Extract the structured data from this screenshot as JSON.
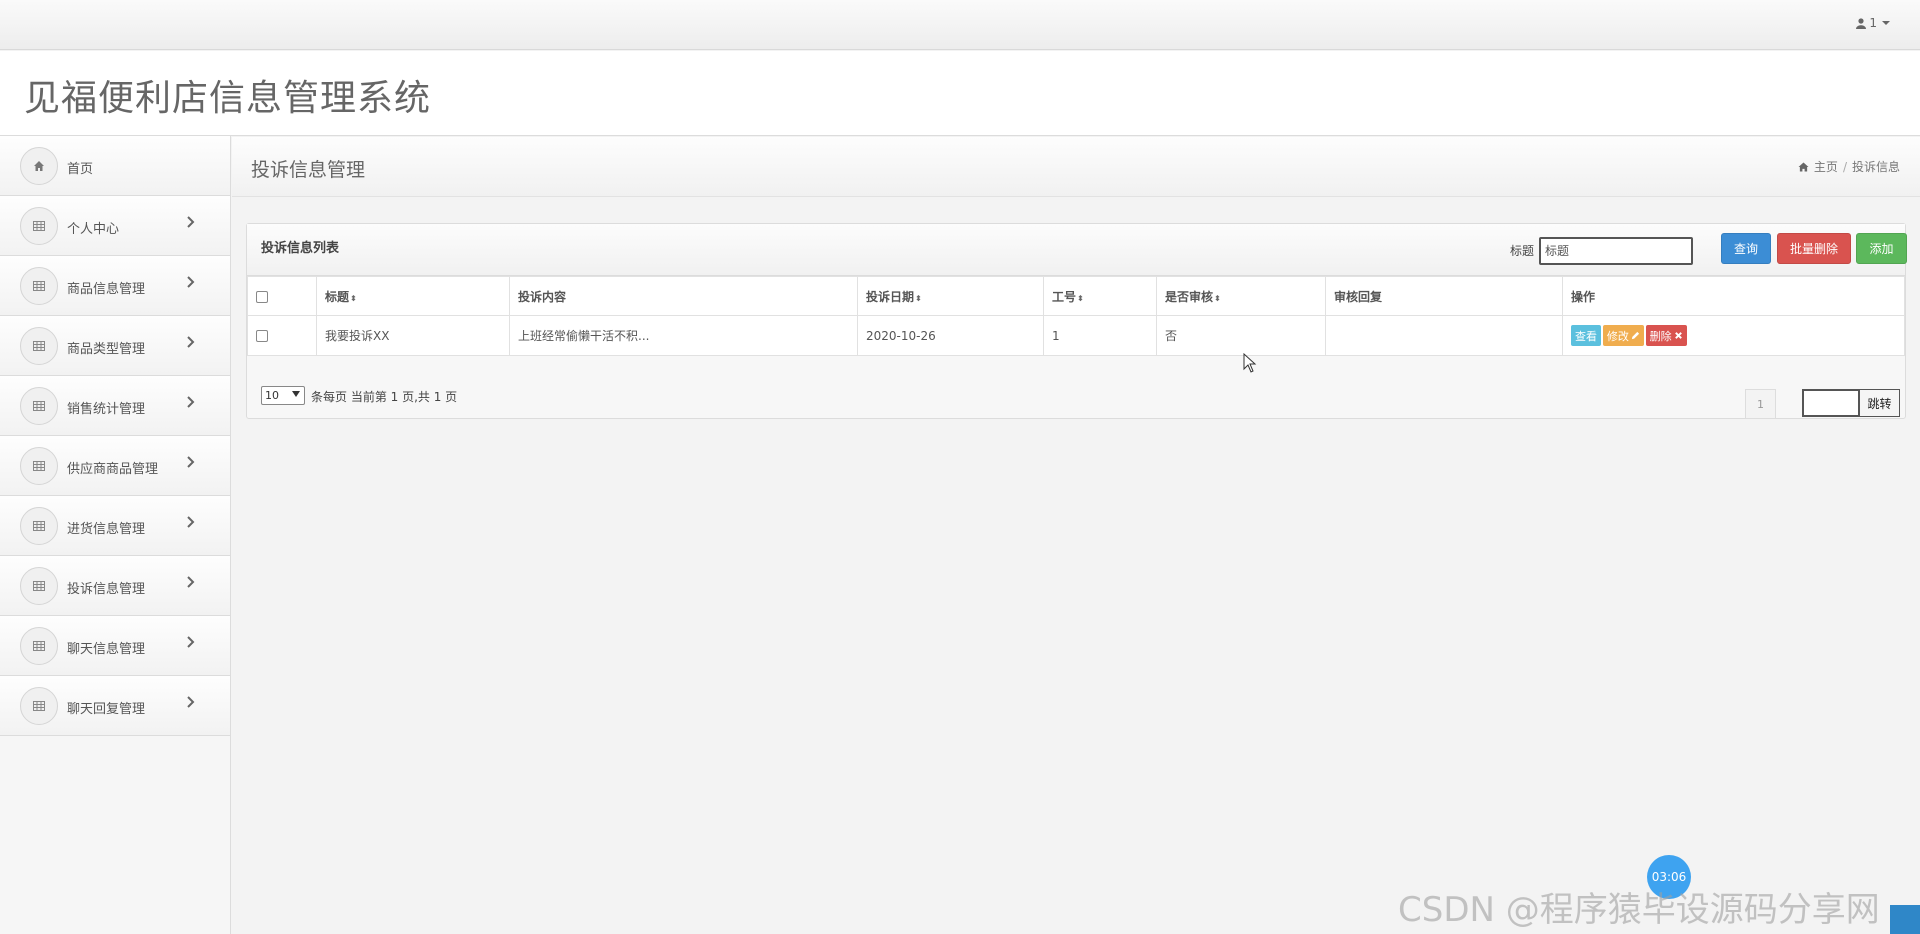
{
  "topbar": {
    "user_label": "1"
  },
  "header": {
    "app_title": "见福便利店信息管理系统"
  },
  "sidebar": {
    "items": [
      {
        "label": "首页",
        "icon": "home-icon",
        "has_arrow": false
      },
      {
        "label": "个人中心",
        "icon": "table-icon",
        "has_arrow": true
      },
      {
        "label": "商品信息管理",
        "icon": "table-icon",
        "has_arrow": true
      },
      {
        "label": "商品类型管理",
        "icon": "table-icon",
        "has_arrow": true
      },
      {
        "label": "销售统计管理",
        "icon": "table-icon",
        "has_arrow": true
      },
      {
        "label": "供应商商品管理",
        "icon": "table-icon",
        "has_arrow": true
      },
      {
        "label": "进货信息管理",
        "icon": "table-icon",
        "has_arrow": true
      },
      {
        "label": "投诉信息管理",
        "icon": "table-icon",
        "has_arrow": true
      },
      {
        "label": "聊天信息管理",
        "icon": "table-icon",
        "has_arrow": true
      },
      {
        "label": "聊天回复管理",
        "icon": "table-icon",
        "has_arrow": true
      }
    ]
  },
  "main": {
    "page_title": "投诉信息管理",
    "breadcrumb": {
      "home": "主页",
      "separator": "/",
      "current": "投诉信息"
    },
    "panel": {
      "title": "投诉信息列表",
      "search": {
        "label": "标题",
        "placeholder": "标题"
      },
      "buttons": {
        "query": "查询",
        "batch_delete": "批量删除",
        "add": "添加"
      },
      "table": {
        "columns": [
          "标题",
          "投诉内容",
          "投诉日期",
          "工号",
          "是否审核",
          "审核回复",
          "操作"
        ],
        "sortable": [
          true,
          false,
          true,
          true,
          true,
          false,
          false
        ],
        "rows": [
          {
            "title": "我要投诉XX",
            "content": "上班经常偷懒干活不积...",
            "date": "2020-10-26",
            "job_no": "1",
            "reviewed": "否",
            "reply": ""
          }
        ],
        "row_actions": {
          "view": "查看",
          "edit": "修改",
          "delete": "删除"
        }
      },
      "pager": {
        "page_size": "10",
        "info": "条每页 当前第 1 页,共 1 页",
        "current_page": "1",
        "jump_label": "跳转"
      }
    }
  },
  "overlay": {
    "timer": "03:06",
    "watermark": "CSDN @程序猿毕设源码分享网"
  },
  "colors": {
    "query_button": "#3c8dd5",
    "danger": "#d9534f",
    "success": "#5cb85c",
    "info": "#5bc0de",
    "warning": "#f0ad4e"
  }
}
